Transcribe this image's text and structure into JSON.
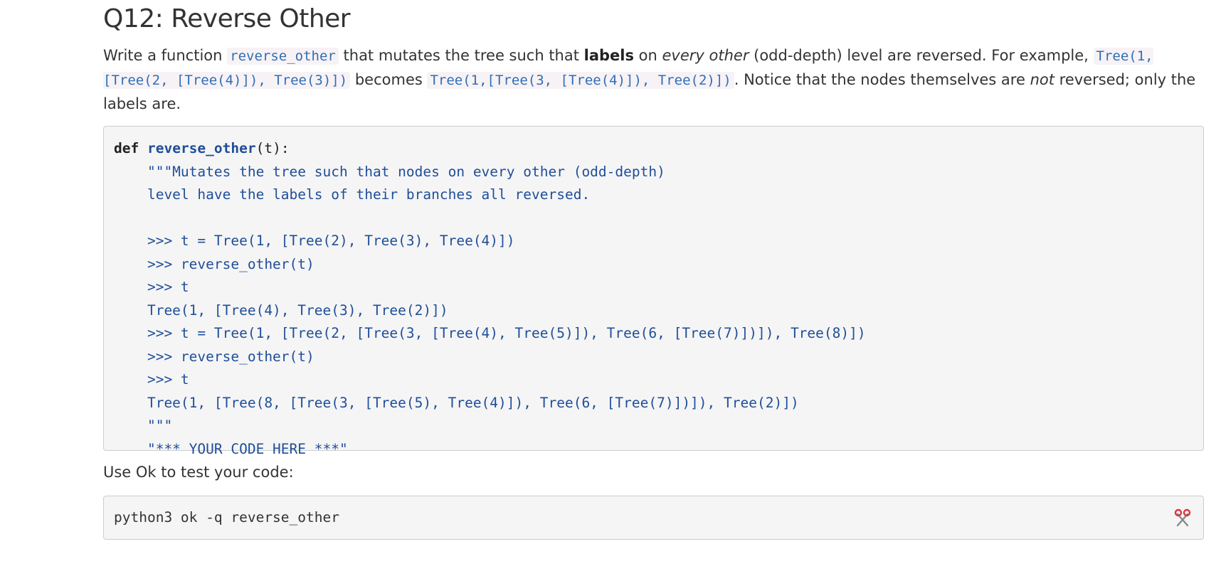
{
  "question": {
    "title": "Q12: Reverse Other",
    "intro_1": "Write a function ",
    "fn_name": "reverse_other",
    "intro_2": " that mutates the tree such that ",
    "labels_bold": "labels",
    "intro_3": " on ",
    "every_other_italic": "every other",
    "intro_4": " (odd-depth) level are reversed. For example, ",
    "example_before": "Tree(1,[Tree(2, [Tree(4)]), Tree(3)])",
    "intro_5": " becomes ",
    "example_after": "Tree(1,[Tree(3, [Tree(4)]), Tree(2)])",
    "intro_6": ". Notice that the nodes themselves are ",
    "not_italic": "not",
    "intro_7": " reversed; only the labels are."
  },
  "code": {
    "def_kw": "def",
    "fn_name": "reverse_other",
    "signature_rest": "(t):",
    "body_lines": [
      "    \"\"\"Mutates the tree such that nodes on every other (odd-depth)",
      "    level have the labels of their branches all reversed.",
      "",
      "    >>> t = Tree(1, [Tree(2), Tree(3), Tree(4)])",
      "    >>> reverse_other(t)",
      "    >>> t",
      "    Tree(1, [Tree(4), Tree(3), Tree(2)])",
      "    >>> t = Tree(1, [Tree(2, [Tree(3, [Tree(4), Tree(5)]), Tree(6, [Tree(7)])]), Tree(8)])",
      "    >>> reverse_other(t)",
      "    >>> t",
      "    Tree(1, [Tree(8, [Tree(3, [Tree(5), Tree(4)]), Tree(6, [Tree(7)])]), Tree(2)])",
      "    \"\"\"",
      "    \"*** YOUR CODE HERE ***\""
    ]
  },
  "test": {
    "label": "Use Ok to test your code:",
    "command": "python3 ok -q reverse_other",
    "copy_icon": "scissors-icon"
  },
  "colors": {
    "code_blue": "#1f4e99",
    "inline_code": "#2f6fb5",
    "scissors_red": "#d9363e"
  }
}
